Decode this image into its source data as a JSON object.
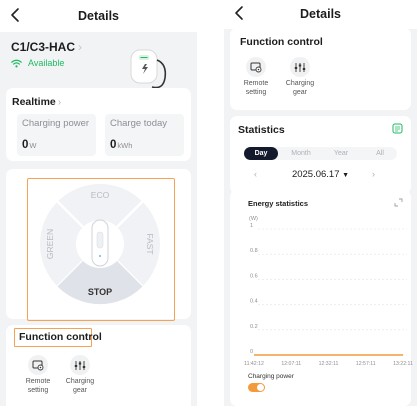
{
  "left": {
    "header": {
      "title": "Details"
    },
    "device": {
      "name": "C1/C3-HAC",
      "status": "Available"
    },
    "realtime": {
      "title": "Realtime",
      "charging_power": {
        "label": "Charging power",
        "value": "0",
        "unit": "W"
      },
      "charging_today": {
        "label": "Charge today",
        "value": "0",
        "unit": "kWh"
      }
    },
    "modes": {
      "top": "ECO",
      "left": "GREEN",
      "right": "FAST",
      "bottom": "STOP"
    },
    "function_control": {
      "title": "Function control",
      "items": [
        {
          "label_line1": "Remote",
          "label_line2": "setting",
          "icon": "remote-setting-icon"
        },
        {
          "label_line1": "Charging",
          "label_line2": "gear",
          "icon": "charging-gear-icon"
        }
      ]
    }
  },
  "right": {
    "header": {
      "title": "Details"
    },
    "function_control": {
      "title": "Function control",
      "items": [
        {
          "label_line1": "Remote",
          "label_line2": "setting",
          "icon": "remote-setting-icon"
        },
        {
          "label_line1": "Charging",
          "label_line2": "gear",
          "icon": "charging-gear-icon"
        }
      ]
    },
    "statistics": {
      "title": "Statistics",
      "tabs": [
        "Day",
        "Month",
        "Year",
        "All"
      ],
      "active_tab": "Day",
      "date": "2025.06.17",
      "energy_title": "Energy statistics",
      "legend": "Charging power"
    }
  },
  "colors": {
    "accent": "#f39a3a",
    "dark_tab": "#141a2e",
    "available": "#1dbb62",
    "highlight_border": "#f5a254"
  },
  "chart_data": {
    "type": "line",
    "title": "Energy statistics",
    "ylabel": "(W)",
    "ylim": [
      0,
      1
    ],
    "yticks": [
      "1",
      "0.8",
      "0.6",
      "0.4",
      "0.2",
      "0"
    ],
    "x": [
      "11:42:12",
      "12:07:11",
      "12:32:11",
      "12:57:11",
      "13:22:11"
    ],
    "series": [
      {
        "name": "Charging power",
        "values": [
          0,
          0,
          0,
          0,
          0
        ]
      }
    ],
    "grid": true,
    "legend_position": "bottom-left"
  }
}
